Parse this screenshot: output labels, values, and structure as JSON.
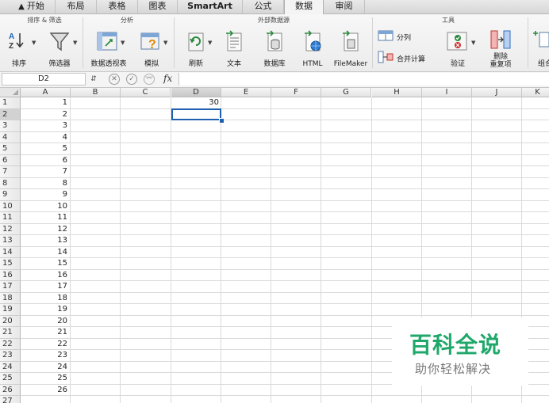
{
  "tabs": [
    {
      "label": "开始",
      "home": true
    },
    {
      "label": "布局"
    },
    {
      "label": "表格"
    },
    {
      "label": "图表"
    },
    {
      "label": "SmartArt"
    },
    {
      "label": "公式"
    },
    {
      "label": "数据",
      "active": true
    },
    {
      "label": "审阅"
    }
  ],
  "ribbon": {
    "groups": {
      "sort_filter": "排序 & 筛选",
      "analysis": "分析",
      "external": "外部数据源",
      "tools": "工具"
    },
    "buttons": {
      "sort": "排序",
      "filter": "筛选器",
      "pivot": "数据透视表",
      "whatif": "模拟",
      "refresh": "刷新",
      "text": "文本",
      "database": "数据库",
      "html": "HTML",
      "filemaker": "FileMaker",
      "split": "分列",
      "consolidate": "合并计算",
      "validate": "验证",
      "remove_dup_line1": "删除",
      "remove_dup_line2": "重复项",
      "group_partial": "组合"
    }
  },
  "formula_bar": {
    "name_box": "D2",
    "fx": "fx",
    "value": ""
  },
  "sheet": {
    "columns": [
      "A",
      "B",
      "C",
      "D",
      "E",
      "F",
      "G",
      "H",
      "I",
      "J",
      "K"
    ],
    "selected_column": "D",
    "selected_row": "2",
    "rows": [
      "1",
      "2",
      "3",
      "4",
      "5",
      "6",
      "7",
      "8",
      "9",
      "10",
      "11",
      "12",
      "13",
      "14",
      "15",
      "16",
      "17",
      "18",
      "19",
      "20",
      "21",
      "22",
      "23",
      "24",
      "25",
      "26",
      "27"
    ],
    "col_a_values": [
      "1",
      "2",
      "3",
      "4",
      "5",
      "6",
      "7",
      "8",
      "9",
      "10",
      "11",
      "12",
      "13",
      "14",
      "15",
      "16",
      "17",
      "18",
      "19",
      "20",
      "21",
      "22",
      "23",
      "24",
      "25",
      "26"
    ],
    "d1_value": "30",
    "selected_cell": "D2"
  },
  "watermark": {
    "main": "百科全说",
    "sub": "助你轻松解决"
  },
  "colors": {
    "selection": "#1f5fb0",
    "watermark_green": "#20a86b"
  }
}
